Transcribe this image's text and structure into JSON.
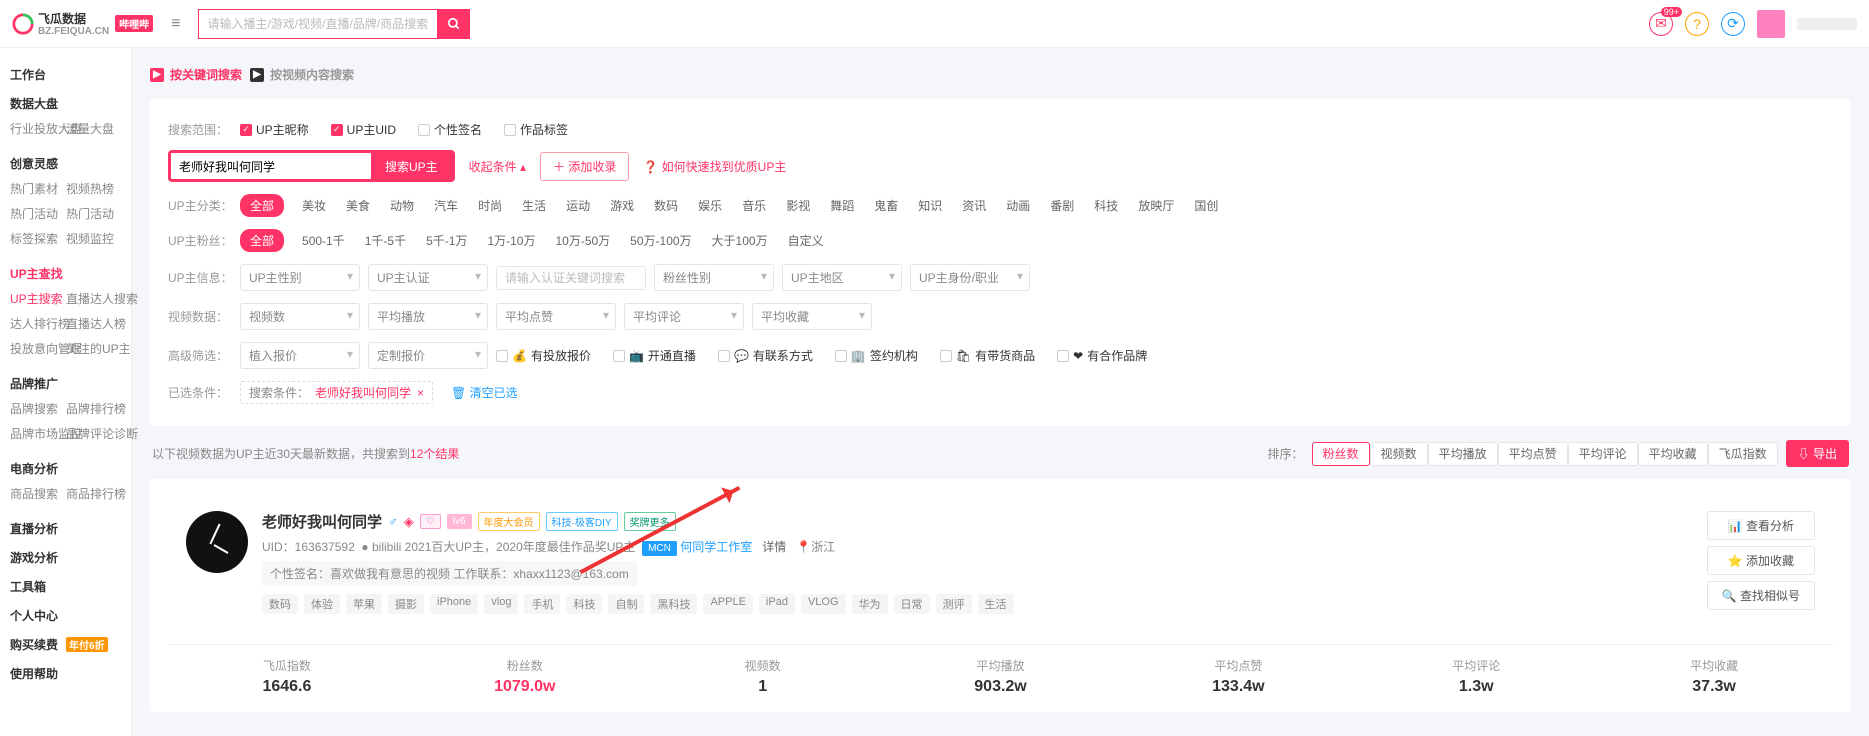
{
  "top": {
    "brand": "飞瓜数据",
    "brand_sub": "BZ.FEIQUA.CN",
    "brand_tag": "哔哩哔",
    "search_ph": "请输入播主/游戏/视频/直播/品牌/商品搜索",
    "msg_badge": "99+"
  },
  "side": {
    "s1": "工作台",
    "s2": "数据大盘",
    "s2a": "行业投放大盘",
    "s2b": "流量大盘",
    "s3": "创意灵感",
    "s3a": "热门素材",
    "s3b": "视频热榜",
    "s3c": "热门活动",
    "s3d": "热门活动",
    "s3e": "标签探索",
    "s3f": "视频监控",
    "s4": "UP主查找",
    "s4a": "UP主搜索",
    "s4b": "直播达人搜索",
    "s4c": "达人排行榜",
    "s4d": "直播达人榜",
    "s4e": "投放意向管理",
    "s4f": "关注的UP主",
    "s5": "品牌推广",
    "s5a": "品牌搜索",
    "s5b": "品牌排行榜",
    "s5c": "品牌市场监控",
    "s5d": "品牌评论诊断",
    "s6": "电商分析",
    "s6a": "商品搜索",
    "s6b": "商品排行榜",
    "s7": "直播分析",
    "s8": "游戏分析",
    "s9": "工具箱",
    "s10": "个人中心",
    "s11": "购买续费",
    "s11tag": "年付6折",
    "s12": "使用帮助"
  },
  "mtab": {
    "a": "按关键词搜索",
    "b": "按视频内容搜索"
  },
  "scope": {
    "lbl": "搜索范围：",
    "a": "UP主昵称",
    "b": "UP主UID",
    "c": "个性签名",
    "d": "作品标签"
  },
  "search": {
    "val": "老师好我叫何同学",
    "btn": "搜索UP主",
    "collapse": "收起条件 ▴",
    "add": "＋ 添加收录",
    "help": "如何快速找到优质UP主"
  },
  "cat": {
    "lbl": "UP主分类：",
    "all": "全部",
    "items": [
      "美妆",
      "美食",
      "动物",
      "汽车",
      "时尚",
      "生活",
      "运动",
      "游戏",
      "数码",
      "娱乐",
      "音乐",
      "影视",
      "舞蹈",
      "鬼畜",
      "知识",
      "资讯",
      "动画",
      "番剧",
      "科技",
      "放映厅",
      "国创"
    ]
  },
  "fans": {
    "lbl": "UP主粉丝：",
    "all": "全部",
    "items": [
      "500-1千",
      "1千-5千",
      "5千-1万",
      "1万-10万",
      "10万-50万",
      "50万-100万",
      "大于100万",
      "自定义"
    ]
  },
  "infoRow": {
    "lbl": "UP主信息：",
    "sex": "UP主性别",
    "cert": "UP主认证",
    "kw": "请输入认证关键词搜索",
    "ftype": "粉丝性别",
    "area": "UP主地区",
    "job": "UP主身份/职业"
  },
  "vidRow": {
    "lbl": "视频数据：",
    "a": "视频数",
    "b": "平均播放",
    "c": "平均点赞",
    "d": "平均评论",
    "e": "平均收藏"
  },
  "adv": {
    "lbl": "高级筛选：",
    "a": "植入报价",
    "b": "定制报价",
    "c1": "有投放报价",
    "c2": "开通直播",
    "c3": "有联系方式",
    "c4": "签约机构",
    "c5": "有带货商品",
    "c6": "有合作品牌"
  },
  "cond": {
    "lbl": "已选条件：",
    "pref": "搜索条件：",
    "val": "老师好我叫何同学",
    "clear": "清空已选"
  },
  "res": {
    "pre": "以下视频数据为UP主近30天最新数据，共搜索到 ",
    "cnt": "12个结果",
    "sortlbl": "排序：",
    "sort": [
      "粉丝数",
      "视频数",
      "平均播放",
      "平均点赞",
      "平均评论",
      "平均收藏",
      "飞瓜指数"
    ],
    "export": "导出"
  },
  "card": {
    "nick": "老师好我叫何同学",
    "lv": "lv6",
    "tags_top": [
      "年度大会员",
      "科技·极客DIY",
      "奖牌更多"
    ],
    "uid_pre": "UID：",
    "uid": "163637592",
    "honors": "bilibili 2021百大UP主，2020年度最佳作品奖UP主",
    "mcn_tag": "MCN",
    "mcn": "何同学工作室",
    "detail": "详情",
    "loc": "浙江",
    "sig_pre": "个性签名：",
    "sig": "喜欢做我有意思的视频 工作联系：xhaxx1123@163.com",
    "vtags": [
      "数码",
      "体验",
      "苹果",
      "摄影",
      "iPhone",
      "vlog",
      "手机",
      "科技",
      "自制",
      "黑科技",
      "APPLE",
      "iPad",
      "VLOG",
      "华为",
      "日常",
      "测评",
      "生活"
    ],
    "btn1": "查看分析",
    "btn2": "添加收藏",
    "btn3": "查找相似号",
    "stats": [
      {
        "lbl": "飞瓜指数",
        "val": "1646.6"
      },
      {
        "lbl": "粉丝数",
        "val": "1079.0w",
        "hot": true
      },
      {
        "lbl": "视频数",
        "val": "1"
      },
      {
        "lbl": "平均播放",
        "val": "903.2w"
      },
      {
        "lbl": "平均点赞",
        "val": "133.4w"
      },
      {
        "lbl": "平均评论",
        "val": "1.3w"
      },
      {
        "lbl": "平均收藏",
        "val": "37.3w"
      }
    ]
  }
}
